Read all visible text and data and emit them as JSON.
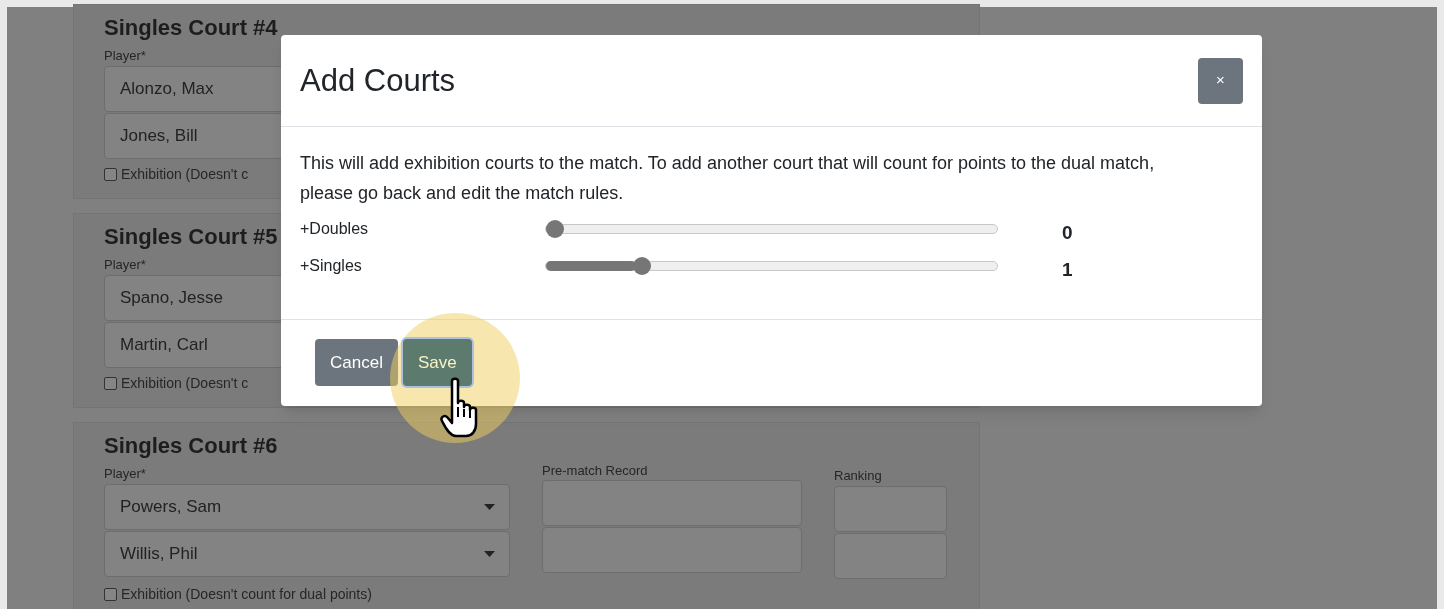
{
  "courts": [
    {
      "title": "Singles Court #4",
      "player_label": "Player*",
      "players": [
        {
          "name": "Alonzo, Max"
        },
        {
          "name": "Jones, Bill"
        }
      ],
      "exhibition": {
        "label": "Exhibition (Doesn't c",
        "checked": false
      }
    },
    {
      "title": "Singles Court #5",
      "player_label": "Player*",
      "players": [
        {
          "name": "Spano, Jesse"
        },
        {
          "name": "Martin, Carl"
        }
      ],
      "exhibition": {
        "label": "Exhibition (Doesn't c",
        "checked": false
      }
    },
    {
      "title": "Singles Court #6",
      "player_label": "Player*",
      "record_label": "Pre-match Record",
      "ranking_label": "Ranking",
      "players": [
        {
          "name": "Powers, Sam"
        },
        {
          "name": "Willis, Phil"
        }
      ],
      "exhibition": {
        "label": "Exhibition (Doesn't count for dual points)",
        "checked": false
      }
    }
  ],
  "modal": {
    "title": "Add Courts",
    "close": "×",
    "text": "This will add exhibition courts to the match. To add another court that will count for points to the dual match, please go back and edit the match rules.",
    "sliders": [
      {
        "label": "+Doubles",
        "level": 0,
        "reading": "0"
      },
      {
        "label": "+Singles",
        "level": 0.2,
        "reading": "1"
      }
    ],
    "buttons": [
      {
        "label": "Cancel",
        "kind": "cancel"
      },
      {
        "label": "Save",
        "kind": "save"
      }
    ]
  }
}
